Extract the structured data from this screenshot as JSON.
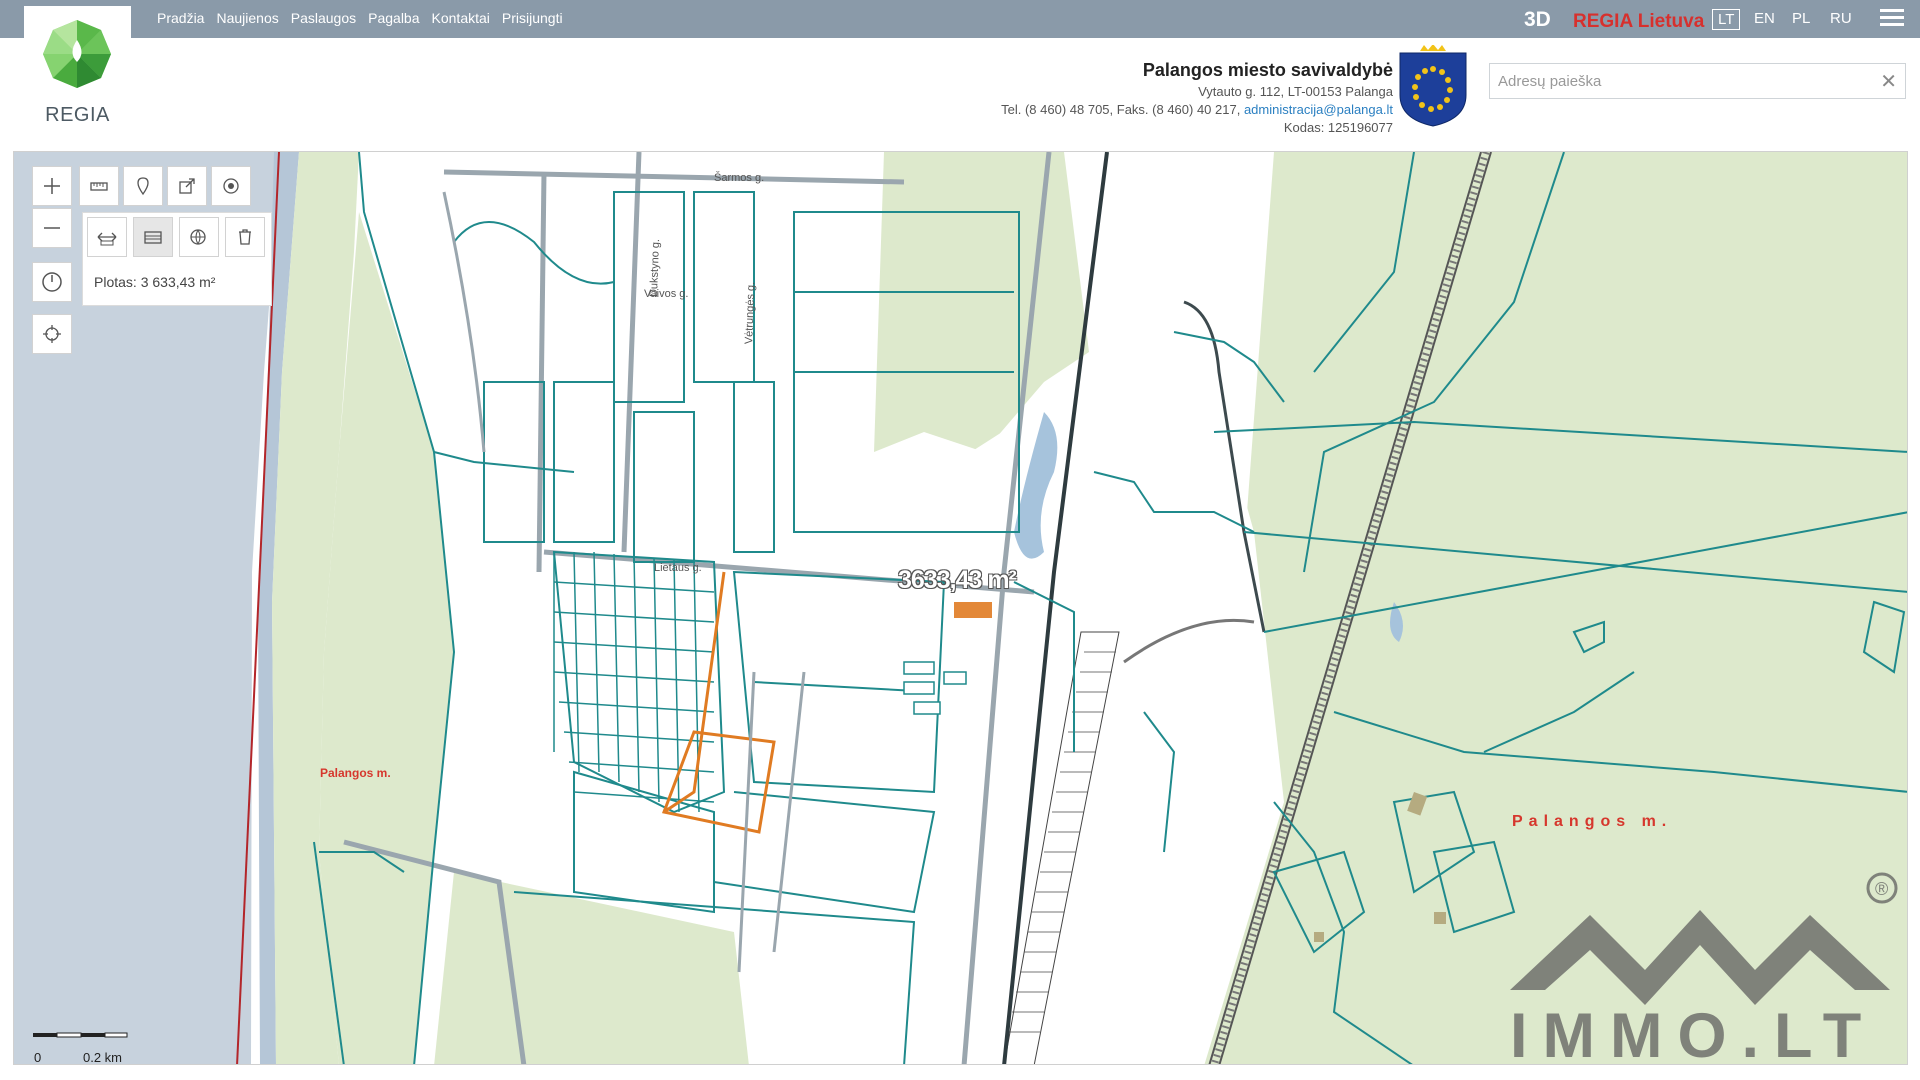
{
  "brand": {
    "logo_text": "REGIA"
  },
  "nav": [
    "Pradžia",
    "Naujienos",
    "Paslaugos",
    "Pagalba",
    "Kontaktai",
    "Prisijungti"
  ],
  "topright": {
    "three_d": "3D",
    "regia_lietuva": "REGIA Lietuva",
    "languages": [
      {
        "label": "LT",
        "active": true
      },
      {
        "label": "EN",
        "active": false
      },
      {
        "label": "PL",
        "active": false
      },
      {
        "label": "RU",
        "active": false
      }
    ]
  },
  "municipality": {
    "title": "Palangos miesto savivaldybė",
    "address": "Vytauto g. 112, LT-00153 Palanga",
    "phone_prefix": "Tel. (8 460) 48 705, Faks. (8 460) 40 217, ",
    "email": "administracija@palanga.lt",
    "code": "Kodas: 125196077"
  },
  "search": {
    "placeholder": "Adresų paieška",
    "clear": "✕"
  },
  "map": {
    "area_text": "Plotas: 3 633,43 m²",
    "measure_label": "3633,43 m²",
    "place_label_left": "Palangos m.",
    "place_label_right": "Palangos m.",
    "streets": [
      "Šarmos g.",
      "Dukstyno g.",
      "Vaivos g.",
      "Vėtrungės g.",
      "Lietaus g."
    ],
    "scale_zero": "0",
    "scale_end": "0.2 km"
  },
  "watermark": {
    "text": "IMMO.LT",
    "registered": "®"
  },
  "colors": {
    "topbar": "#8a9aa9",
    "parcel": "#1f8a8c",
    "green": "#dde9cc",
    "water_strip": "#b5c6d7",
    "sea": "#c7d2dd",
    "road": "#9aa6ae",
    "selection": "#e07b22",
    "label_red": "#d6372d"
  },
  "icons": {
    "zoom_in": "plus-icon",
    "zoom_out": "minus-icon",
    "measure": "ruler-icon",
    "marker": "map-pin-icon",
    "share": "share-icon",
    "locate": "target-icon",
    "history": "clock-icon",
    "gps": "crosshair-icon",
    "measure_distance": "distance-icon",
    "measure_area": "area-icon",
    "clear_measure": "trash-icon"
  }
}
